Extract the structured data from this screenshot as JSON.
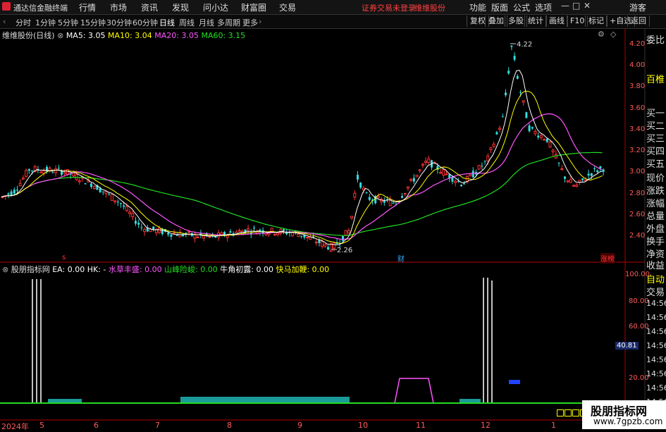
{
  "app": {
    "title": "通达信金融终端"
  },
  "menu": [
    "行情",
    "市场",
    "资讯",
    "发现",
    "问小达",
    "财富圈",
    "交易"
  ],
  "status_warning": "证券交易未登录",
  "stock_name": "维维股份",
  "right_menu": [
    "功能",
    "版面",
    "公式",
    "选项"
  ],
  "user": "游客",
  "window_controls": {
    "minimize": "—",
    "maximize": "□",
    "close": "✕"
  },
  "periods": [
    "分时",
    "1分钟",
    "5分钟",
    "15分钟",
    "30分钟",
    "60分钟",
    "日线",
    "周线",
    "月线",
    "多周期",
    "更多"
  ],
  "active_period": "日线",
  "toolbar_buttons": [
    "复权",
    "叠加",
    "多股",
    "统计",
    "画线",
    "F10",
    "标记",
    "+自选",
    "返回"
  ],
  "main_legend": {
    "title": "维维股份(日线)",
    "items": [
      {
        "label": "MA5: 3.05",
        "color": "#ffffff"
      },
      {
        "label": "MA10: 3.04",
        "color": "#ffff00"
      },
      {
        "label": "MA20: 3.05",
        "color": "#ff55ff"
      },
      {
        "label": "MA60: 3.15",
        "color": "#22dd22"
      }
    ]
  },
  "price_axis": [
    "4.20",
    "4.00",
    "3.80",
    "3.60",
    "3.40",
    "3.20",
    "3.00",
    "2.80",
    "2.60",
    "2.40"
  ],
  "annotations": {
    "high": "4.22",
    "low": "2.26",
    "finance_marker": "财",
    "limit_tag": "涨榜"
  },
  "sub_legend": {
    "title": "股朋指标网",
    "items": [
      {
        "label": "EA: 0.00",
        "color": "#ffffff"
      },
      {
        "label": "HK: -",
        "color": "#ffffff"
      },
      {
        "label": "水草丰盛: 0.00",
        "color": "#ff55ff"
      },
      {
        "label": "山峰险峻: 0.00",
        "color": "#22dd22"
      },
      {
        "label": "牛角初露: 0.00",
        "color": "#ffffff"
      },
      {
        "label": "快马加鞭: 0.00",
        "color": "#ffff00"
      }
    ]
  },
  "sub_axis": [
    "100.00",
    "80.00",
    "60.00",
    "40.00",
    "20.00"
  ],
  "sub_current": "40.81",
  "x_axis": {
    "year_label": "2024年",
    "months": [
      "5",
      "6",
      "7",
      "8",
      "9",
      "10",
      "11",
      "12",
      "1"
    ]
  },
  "side_panel": [
    "委比",
    "百椎",
    "买一",
    "买二",
    "买三",
    "买四",
    "买五",
    "现价",
    "涨跌",
    "涨幅",
    "总量",
    "外盘",
    "换手",
    "净资",
    "收益"
  ],
  "side_panel_lower": [
    "自动",
    "交易",
    "14:56",
    "14:56",
    "14:56",
    "14:56",
    "14:56",
    "14:56",
    "14:56",
    "14:56",
    "14:56"
  ],
  "watermark": {
    "text": "股朋指标网",
    "url": "www.7gpzb.com"
  },
  "colors": {
    "up": "#ff3333",
    "down": "#33dddd",
    "ma5": "#ffffff",
    "ma10": "#ffff00",
    "ma20": "#ff55ff",
    "ma60": "#22dd22",
    "axis": "#b00000"
  }
}
